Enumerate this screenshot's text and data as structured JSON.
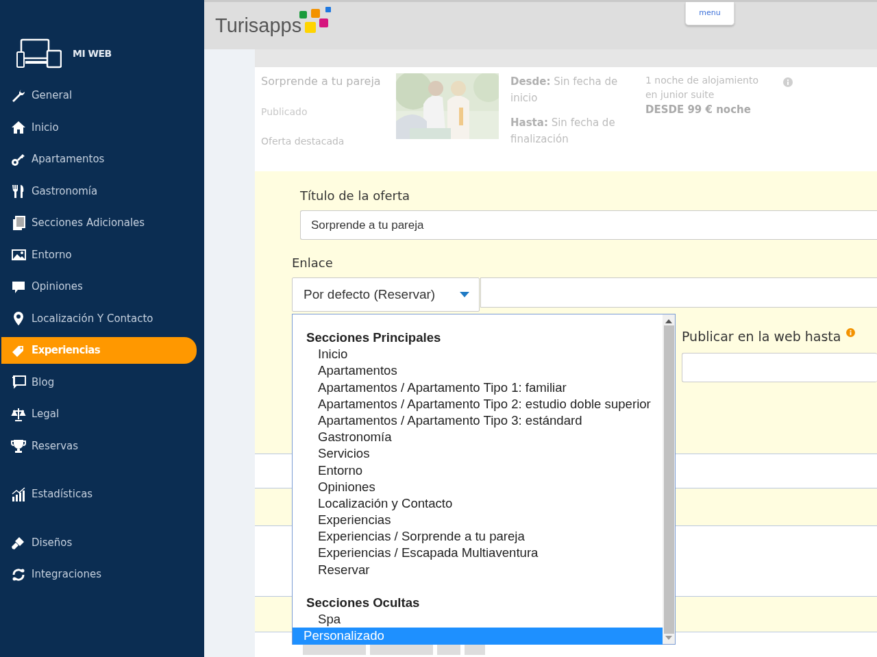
{
  "sidebar": {
    "title": "MI WEB",
    "sections": [
      {
        "items": [
          {
            "label": "General",
            "selected": false
          },
          {
            "label": "Inicio",
            "selected": false
          },
          {
            "label": "Apartamentos",
            "selected": false
          },
          {
            "label": "Gastronomía",
            "selected": false
          },
          {
            "label": "Secciones Adicionales",
            "selected": false
          },
          {
            "label": "Entorno",
            "selected": false
          },
          {
            "label": "Opiniones",
            "selected": false
          },
          {
            "label": "Localización Y Contacto",
            "selected": false
          },
          {
            "label": "Experiencias",
            "selected": true
          },
          {
            "label": "Blog",
            "selected": false
          },
          {
            "label": "Legal",
            "selected": false
          },
          {
            "label": "Reservas",
            "selected": false
          }
        ]
      },
      {
        "items": [
          {
            "label": "Estadísticas",
            "selected": false
          }
        ]
      },
      {
        "items": [
          {
            "label": "Diseños",
            "selected": false
          },
          {
            "label": "Integraciones",
            "selected": false
          }
        ]
      }
    ]
  },
  "top_bar": {
    "brand": "Turisapps",
    "menu_button": "menu"
  },
  "offer_row": {
    "title": "Sorprende a tu pareja",
    "status": "Publicado",
    "featured": "Oferta destacada",
    "image": {
      "kind": "picture"
    },
    "visible": [
      "**Desde:** Sin fecha de inicio",
      "**Hasta:** Sin fecha de finalización"
    ],
    "short_description": "1 noche de alojamiento en junior suite",
    "price": "DESDE 99 € noche"
  },
  "form": {
    "title_label": "Título de la oferta",
    "title_value": "Sorprende a tu pareja",
    "link_label": "Enlace",
    "link_select": "Por defecto (Reservar)",
    "publish_label": "Publicar en la web hasta",
    "link_options": [
      {
        "kind": "header",
        "label": "Secciones Principales"
      },
      {
        "kind": "option",
        "label": "Inicio",
        "selected": false
      },
      {
        "kind": "option",
        "label": "Apartamentos",
        "selected": false
      },
      {
        "kind": "option",
        "label": "Apartamentos / Apartamento Tipo 1: familiar",
        "selected": false
      },
      {
        "kind": "option",
        "label": "Apartamentos / Apartamento Tipo 2: estudio doble superior",
        "selected": false
      },
      {
        "kind": "option",
        "label": "Apartamentos / Apartamento Tipo 3: estándard",
        "selected": false
      },
      {
        "kind": "option",
        "label": "Gastronomía",
        "selected": false
      },
      {
        "kind": "option",
        "label": "Servicios",
        "selected": false
      },
      {
        "kind": "option",
        "label": "Entorno",
        "selected": false
      },
      {
        "kind": "option",
        "label": "Opiniones",
        "selected": false
      },
      {
        "kind": "option",
        "label": "Localización y Contacto",
        "selected": false
      },
      {
        "kind": "option",
        "label": "Experiencias",
        "selected": false
      },
      {
        "kind": "option",
        "label": "Experiencias / Sorprende a tu pareja",
        "selected": false
      },
      {
        "kind": "option",
        "label": "Experiencias / Escapada Multiaventura",
        "selected": false
      },
      {
        "kind": "option",
        "label": "Reservar",
        "selected": false
      },
      {
        "kind": "header",
        "label": "Secciones Ocultas"
      },
      {
        "kind": "option",
        "label": "Spa",
        "selected": false
      },
      {
        "kind": "top-option",
        "label": "Personalizado",
        "selected": true
      }
    ]
  }
}
